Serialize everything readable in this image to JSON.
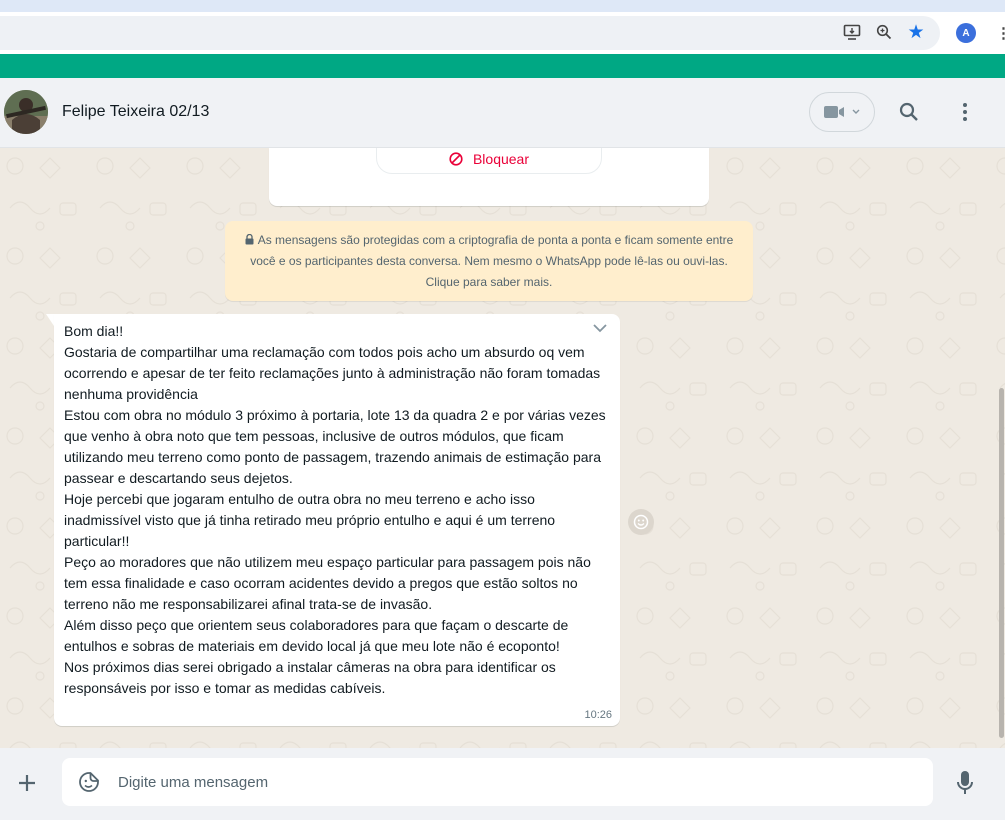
{
  "browser": {
    "icons": [
      "cast-icon",
      "zoom-icon",
      "bookmark-star-icon"
    ],
    "profile_initial": "A"
  },
  "chat": {
    "name": "Felipe Teixeira 02/13"
  },
  "contact_card": {
    "block_label": "Bloquear"
  },
  "encryption_notice": "As mensagens são protegidas com a criptografia de ponta a ponta e ficam somente entre você e os participantes desta conversa. Nem mesmo o WhatsApp pode lê-las ou ouvi-las. Clique para saber mais.",
  "message": {
    "text": "Bom dia!!\nGostaria de compartilhar uma reclamação com todos pois acho um absurdo oq vem ocorrendo e apesar de ter feito reclamações junto à administração não foram tomadas nenhuma providência\nEstou com obra no módulo 3 próximo à portaria, lote 13 da quadra 2 e por várias vezes que venho à obra noto que tem pessoas, inclusive de outros módulos, que ficam utilizando meu terreno como ponto de passagem, trazendo animais de estimação para passear e descartando seus dejetos.\nHoje percebi que jogaram entulho de outra obra no meu terreno e acho isso inadmissível visto que já tinha retirado meu próprio entulho e aqui é um terreno particular!!\nPeço ao moradores que não utilizem meu espaço particular para passagem pois não tem essa finalidade e caso ocorram acidentes devido a pregos que estão soltos no terreno não me responsabilizarei afinal trata-se de invasão.\nAlém disso peço que orientem seus colaboradores para que façam o descarte de entulhos e sobras de materiais em devido local já que meu lote não é ecoponto!\nNos próximos dias serei obrigado a instalar câmeras na obra para identificar os responsáveis por isso e tomar as medidas cabíveis.",
    "time": "10:26"
  },
  "composer": {
    "placeholder": "Digite uma mensagem"
  },
  "colors": {
    "accent": "#00a884",
    "chat_bg": "#efeae2",
    "block_red": "#ea0038",
    "notice_bg": "#ffeecd"
  }
}
